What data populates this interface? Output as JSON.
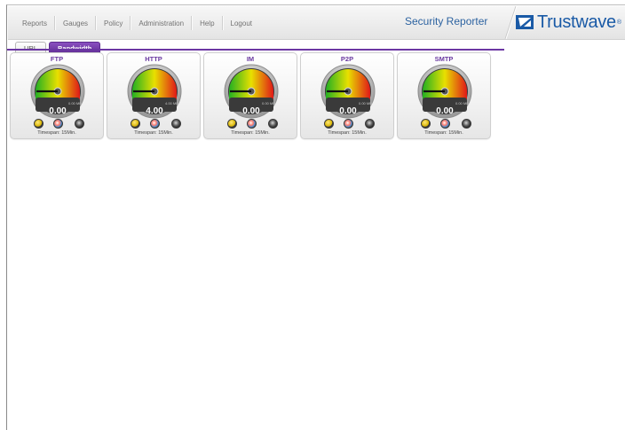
{
  "header": {
    "menu": [
      {
        "label": "Reports",
        "name": "menu-reports"
      },
      {
        "label": "Gauges",
        "name": "menu-gauges"
      },
      {
        "label": "Policy",
        "name": "menu-policy"
      },
      {
        "label": "Administration",
        "name": "menu-administration"
      },
      {
        "label": "Help",
        "name": "menu-help"
      },
      {
        "label": "Logout",
        "name": "menu-logout"
      }
    ],
    "app_title": "Security Reporter",
    "brand": "Trustwave",
    "brand_mark": "®"
  },
  "tabs": [
    {
      "label": "URL",
      "active": false
    },
    {
      "label": "Bandwidth",
      "active": true
    }
  ],
  "gauges": [
    {
      "title": "FTP",
      "value": "0.00",
      "max": "0.00 MB",
      "timespan": "Timespan: 15Min.",
      "level": 0.0
    },
    {
      "title": "HTTP",
      "value": "4.00",
      "max": "4.00 MB",
      "timespan": "Timespan: 15Min.",
      "level": 0.0
    },
    {
      "title": "IM",
      "value": "0.00",
      "max": "0.00 MB",
      "timespan": "Timespan: 15Min.",
      "level": 0.0
    },
    {
      "title": "P2P",
      "value": "0.00",
      "max": "0.00 MB",
      "timespan": "Timespan: 15Min.",
      "level": 0.0
    },
    {
      "title": "SMTP",
      "value": "0.00",
      "max": "0.00 MB",
      "timespan": "Timespan: 15Min.",
      "level": 0.0
    }
  ],
  "colors": {
    "accent_purple": "#6b36a3",
    "title_blue": "#2c62a0",
    "gauge_green": "#22b022",
    "gauge_yellow": "#e8e000",
    "gauge_red": "#e01818"
  }
}
